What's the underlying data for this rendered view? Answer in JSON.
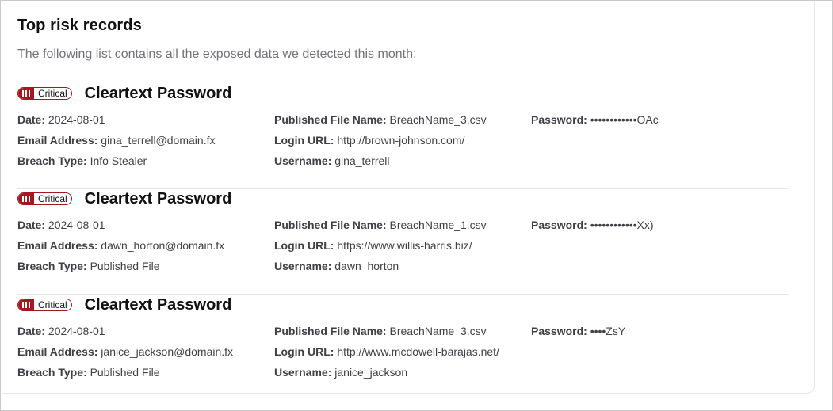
{
  "header": {
    "title": "Top risk records",
    "subtitle": "The following list contains all the exposed data we detected this month:"
  },
  "labels": {
    "date": "Date:",
    "email": "Email Address:",
    "breach_type": "Breach Type:",
    "file_name": "Published File Name:",
    "login_url": "Login URL:",
    "username": "Username:",
    "password": "Password:"
  },
  "colors": {
    "critical": "#a3191f"
  },
  "records": [
    {
      "severity": "Critical",
      "title": "Cleartext Password",
      "date": "2024-08-01",
      "email": "gina_terrell@domain.fx",
      "breach_type": "Info Stealer",
      "file_name": "BreachName_3.csv",
      "login_url": "http://brown-johnson.com/",
      "username": "gina_terrell",
      "password": "••••••••••••OAc"
    },
    {
      "severity": "Critical",
      "title": "Cleartext Password",
      "date": "2024-08-01",
      "email": "dawn_horton@domain.fx",
      "breach_type": "Published File",
      "file_name": "BreachName_1.csv",
      "login_url": "https://www.willis-harris.biz/",
      "username": "dawn_horton",
      "password": "••••••••••••Xx)"
    },
    {
      "severity": "Critical",
      "title": "Cleartext Password",
      "date": "2024-08-01",
      "email": "janice_jackson@domain.fx",
      "breach_type": "Published File",
      "file_name": "BreachName_3.csv",
      "login_url": "http://www.mcdowell-barajas.net/",
      "username": "janice_jackson",
      "password": "••••ZsY"
    }
  ]
}
